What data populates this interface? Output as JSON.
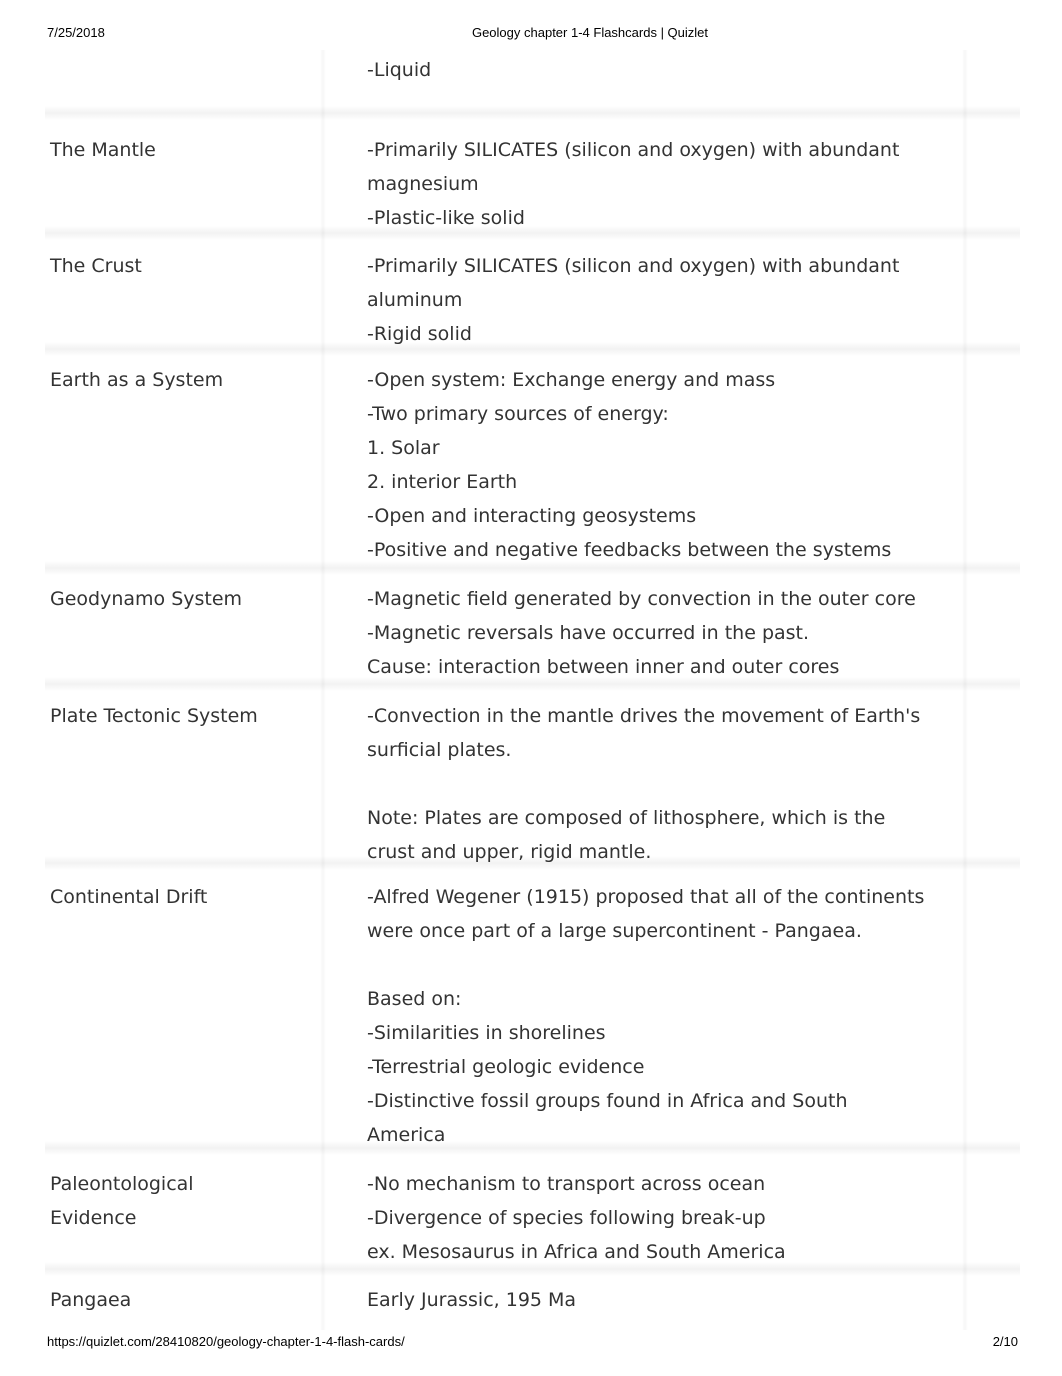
{
  "header": {
    "date": "7/25/2018",
    "title": "Geology chapter 1-4 Flashcards | Quizlet"
  },
  "footer": {
    "url": "https://quizlet.com/28410820/geology-chapter-1-4-flash-cards/",
    "page": "2/10"
  },
  "cards": [
    {
      "term": [],
      "definition": [
        "-Liquid"
      ]
    },
    {
      "term": [
        "The Mantle"
      ],
      "definition": [
        "-Primarily SILICATES (silicon and oxygen) with abundant",
        "magnesium",
        "-Plastic-like solid"
      ]
    },
    {
      "term": [
        "The Crust"
      ],
      "definition": [
        "-Primarily SILICATES (silicon and oxygen) with abundant",
        "aluminum",
        "-Rigid solid"
      ]
    },
    {
      "term": [
        "Earth as a System"
      ],
      "definition": [
        "-Open system: Exchange energy and mass",
        "-Two primary sources of energy:",
        "1. Solar",
        "2. interior Earth",
        "-Open and interacting geosystems",
        "-Positive and negative feedbacks between the systems"
      ]
    },
    {
      "term": [
        "Geodynamo System"
      ],
      "definition": [
        "-Magnetic field generated by convection in the outer core",
        "-Magnetic reversals have occurred in the past.",
        "Cause: interaction between inner and outer cores"
      ]
    },
    {
      "term": [
        "Plate Tectonic System"
      ],
      "definition": [
        "-Convection in the mantle drives the movement of Earth's",
        "surficial plates.",
        "",
        "Note: Plates are composed of lithosphere, which is the",
        "crust and upper, rigid mantle."
      ]
    },
    {
      "term": [
        "Continental Drift"
      ],
      "definition": [
        "-Alfred Wegener (1915) proposed that all of the continents",
        "were once part of a large supercontinent - Pangaea.",
        "",
        "Based on:",
        "-Similarities in shorelines",
        "-Terrestrial geologic evidence",
        "-Distinctive fossil groups found in Africa and South",
        "America"
      ]
    },
    {
      "term": [
        "Paleontological",
        "Evidence"
      ],
      "definition": [
        "-No mechanism to transport across ocean",
        "-Divergence of species following break-up",
        "ex. Mesosaurus in Africa and South America"
      ]
    },
    {
      "term": [
        "Pangaea"
      ],
      "definition": [
        "Early Jurassic, 195 Ma"
      ]
    }
  ]
}
